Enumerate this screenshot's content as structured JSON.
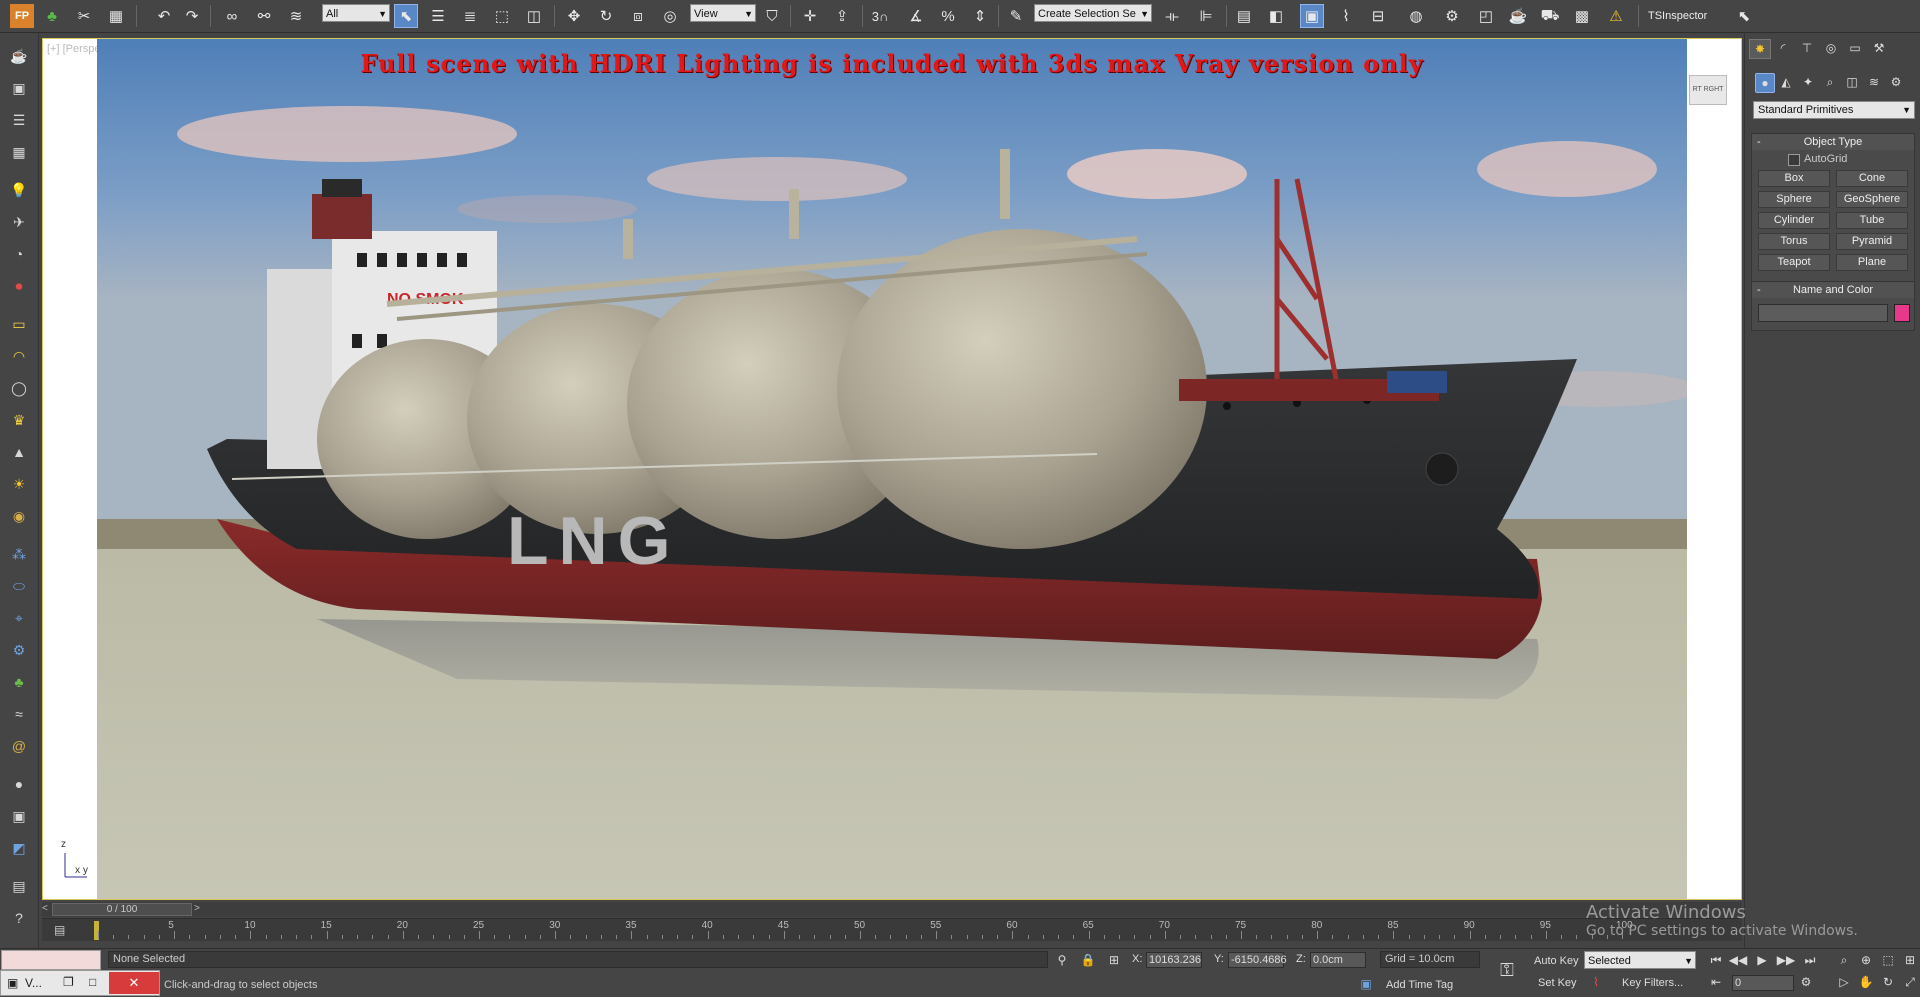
{
  "toolbar": {
    "app_icon": "FP",
    "selection_filter": "All",
    "ref_coord": "View",
    "snap_label": "3",
    "named_selection_placeholder": "Create Selection Se",
    "ts_inspector": "TSInspector",
    "icons": [
      "undo-icon",
      "redo-icon",
      "link-icon",
      "unlink-icon",
      "bind-spacewarp-icon",
      "select-object-icon",
      "select-by-name-icon",
      "rect-region-icon",
      "window-crossing-icon",
      "move-icon",
      "rotate-icon",
      "scale-icon",
      "pivot-icon",
      "snap-icon",
      "angle-snap-icon",
      "percent-snap-icon",
      "spinner-snap-icon",
      "edit-named-sel-icon",
      "mirror-icon",
      "align-icon",
      "layer-icon",
      "scene-explorer-icon",
      "curve-editor-icon",
      "schematic-icon",
      "material-editor-icon",
      "render-setup-icon",
      "render-frame-icon",
      "render-icon",
      "warning-icon"
    ]
  },
  "viewport": {
    "label": "[+] [Perspective]",
    "banner": "Full scene with HDRI Lighting is included with 3ds max Vray version only",
    "hull_text": "LNG",
    "superstructure_text": "NO SMOK",
    "viewcube_text": "RT RGHT",
    "axis": {
      "z": "z",
      "x": "x",
      "y": "y"
    }
  },
  "right_panel": {
    "category": "Standard Primitives",
    "object_type": {
      "title": "Object Type",
      "autogrid": "AutoGrid",
      "buttons": [
        "Box",
        "Cone",
        "Sphere",
        "GeoSphere",
        "Cylinder",
        "Tube",
        "Torus",
        "Pyramid",
        "Teapot",
        "Plane"
      ]
    },
    "name_color": {
      "title": "Name and Color",
      "name_value": "",
      "swatch": "#e8388a"
    }
  },
  "timeline": {
    "slider": "0 / 100",
    "ticks": [
      "5",
      "10",
      "15",
      "20",
      "25",
      "30",
      "35",
      "40",
      "45",
      "50",
      "55",
      "60",
      "65",
      "70",
      "75",
      "80",
      "85",
      "90",
      "95",
      "100"
    ]
  },
  "status": {
    "selection": "None Selected",
    "prompt": "Click-and-drag to select objects",
    "x_label": "X:",
    "x_value": "10163.236",
    "y_label": "Y:",
    "y_value": "-6150.4686",
    "z_label": "Z:",
    "z_value": "0.0cm",
    "grid": "Grid = 10.0cm",
    "add_time_tag": "Add Time Tag",
    "auto_key": "Auto Key",
    "selected": "Selected",
    "set_key": "Set Key",
    "key_filters": "Key Filters...",
    "frame": "0",
    "task_label": "V..."
  },
  "watermark": {
    "line1": "Activate Windows",
    "line2": "Go to PC settings to activate Windows."
  }
}
